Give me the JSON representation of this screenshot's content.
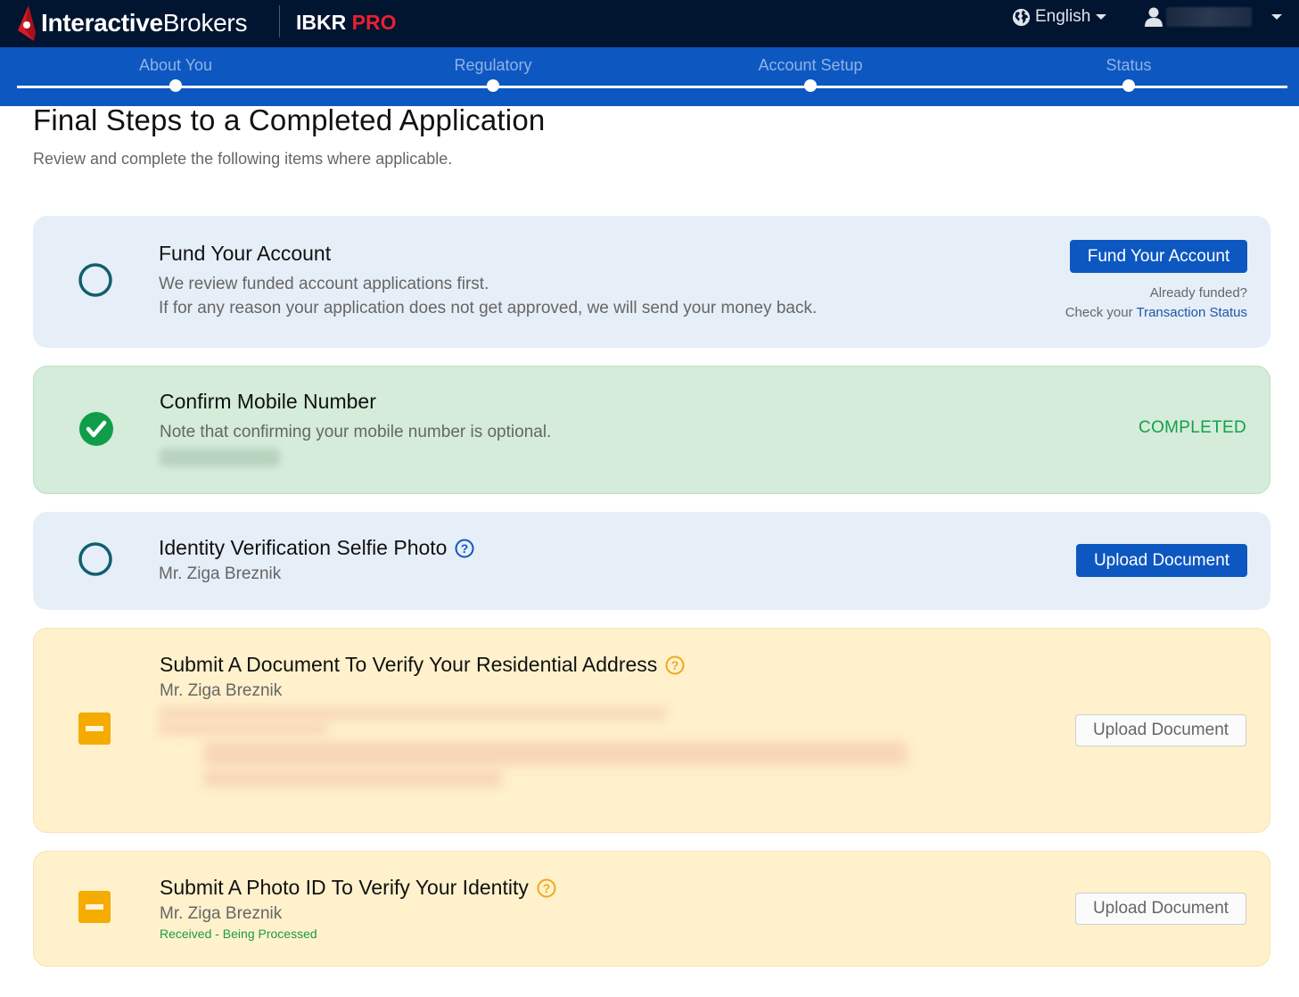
{
  "header": {
    "brand_bold": "Interactive",
    "brand_light": "Brokers",
    "product_name": "IBKR",
    "product_tier": "PRO",
    "language": "English",
    "language_icon": "globe-icon",
    "user_icon": "user-icon"
  },
  "stepper": {
    "steps": [
      {
        "label": "About You"
      },
      {
        "label": "Regulatory"
      },
      {
        "label": "Account Setup"
      },
      {
        "label": "Status"
      }
    ]
  },
  "page": {
    "title": "Final Steps to a Completed Application",
    "subtitle": "Review and complete the following items where applicable."
  },
  "tasks": [
    {
      "title": "Fund Your Account",
      "status": "pending",
      "lines": [
        "We review funded account applications first.",
        "If for any reason your application does not get approved, we will send your money back."
      ],
      "button_label": "Fund Your Account",
      "note_line1": "Already funded?",
      "note_prefix": "Check your",
      "note_link": "Transaction Status"
    },
    {
      "title": "Confirm Mobile Number",
      "status": "completed",
      "lines": [
        "Note that confirming your mobile number is optional."
      ],
      "status_label": "COMPLETED"
    },
    {
      "title": "Identity Verification Selfie Photo",
      "status": "pending",
      "name": "Mr. Ziga Breznik",
      "button_label": "Upload Document"
    },
    {
      "title": "Submit A Document To Verify Your Residential Address",
      "status": "attention",
      "name": "Mr. Ziga Breznik",
      "button_label": "Upload Document"
    },
    {
      "title": "Submit A Photo ID To Verify Your Identity",
      "status": "attention",
      "name": "Mr. Ziga Breznik",
      "sub_status": "Received - Being Processed",
      "button_label": "Upload Document"
    }
  ],
  "colors": {
    "topbar": "#011430",
    "stepper": "#0d57c1",
    "primary_button": "#0d57c1",
    "completed_green": "#14a04a",
    "attention_orange": "#f5ab00",
    "pending_ring": "#115e6e",
    "brand_red": "#e8202f"
  }
}
